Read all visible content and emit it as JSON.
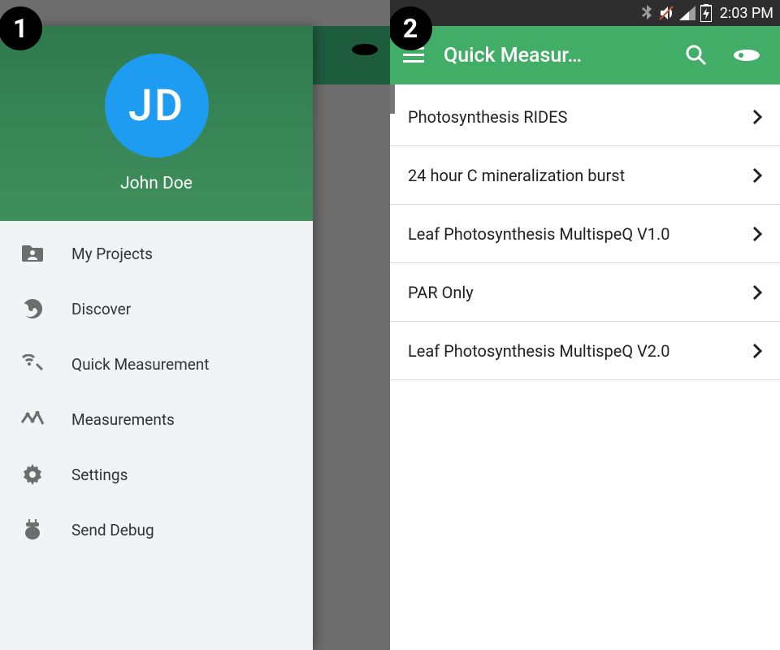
{
  "status": {
    "time": "2:03 PM"
  },
  "step_badges": [
    "1",
    "2"
  ],
  "screen1": {
    "user": {
      "initials": "JD",
      "name": "John Doe"
    },
    "nav": [
      {
        "icon": "folder-person",
        "label": "My Projects"
      },
      {
        "icon": "globe",
        "label": "Discover"
      },
      {
        "icon": "antenna",
        "label": "Quick Measurement"
      },
      {
        "icon": "timeline",
        "label": "Measurements"
      },
      {
        "icon": "gear",
        "label": "Settings"
      },
      {
        "icon": "bug",
        "label": "Send Debug"
      }
    ]
  },
  "screen2": {
    "title": "Quick Measur…",
    "items": [
      "Photosynthesis RIDES",
      "24 hour C mineralization burst",
      "Leaf Photosynthesis MultispeQ V1.0",
      "PAR Only",
      "Leaf Photosynthesis MultispeQ V2.0"
    ]
  }
}
